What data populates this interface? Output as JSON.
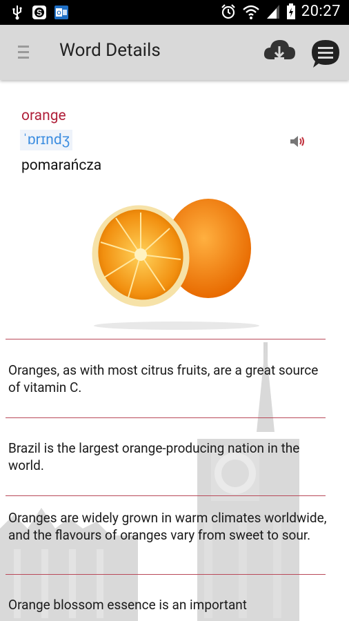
{
  "status": {
    "time": "20:27"
  },
  "actionbar": {
    "title": "Word Details"
  },
  "word": {
    "term": "orange",
    "phonetic": "ˈɒrɪndʒ",
    "translation": "pomarańcza"
  },
  "facts": [
    "Oranges, as with most citrus fruits, are a great source of vitamin C.",
    "Brazil is the largest orange-producing nation in the world.",
    "Oranges are widely grown in warm climates worldwide, and the flavours of oranges vary from sweet to sour.",
    "Orange blossom essence is an important"
  ],
  "colors": {
    "accent": "#b0203a",
    "phonetic": "#3c8de0",
    "actionbar": "#d9d9d9",
    "divider": "#b84858"
  },
  "icons": [
    "usb-icon",
    "s-app-icon",
    "outlook-icon",
    "alarm-icon",
    "wifi-icon",
    "signal-icon",
    "battery-icon",
    "menu-icon",
    "cloud-download-icon",
    "chat-icon",
    "speaker-icon"
  ]
}
